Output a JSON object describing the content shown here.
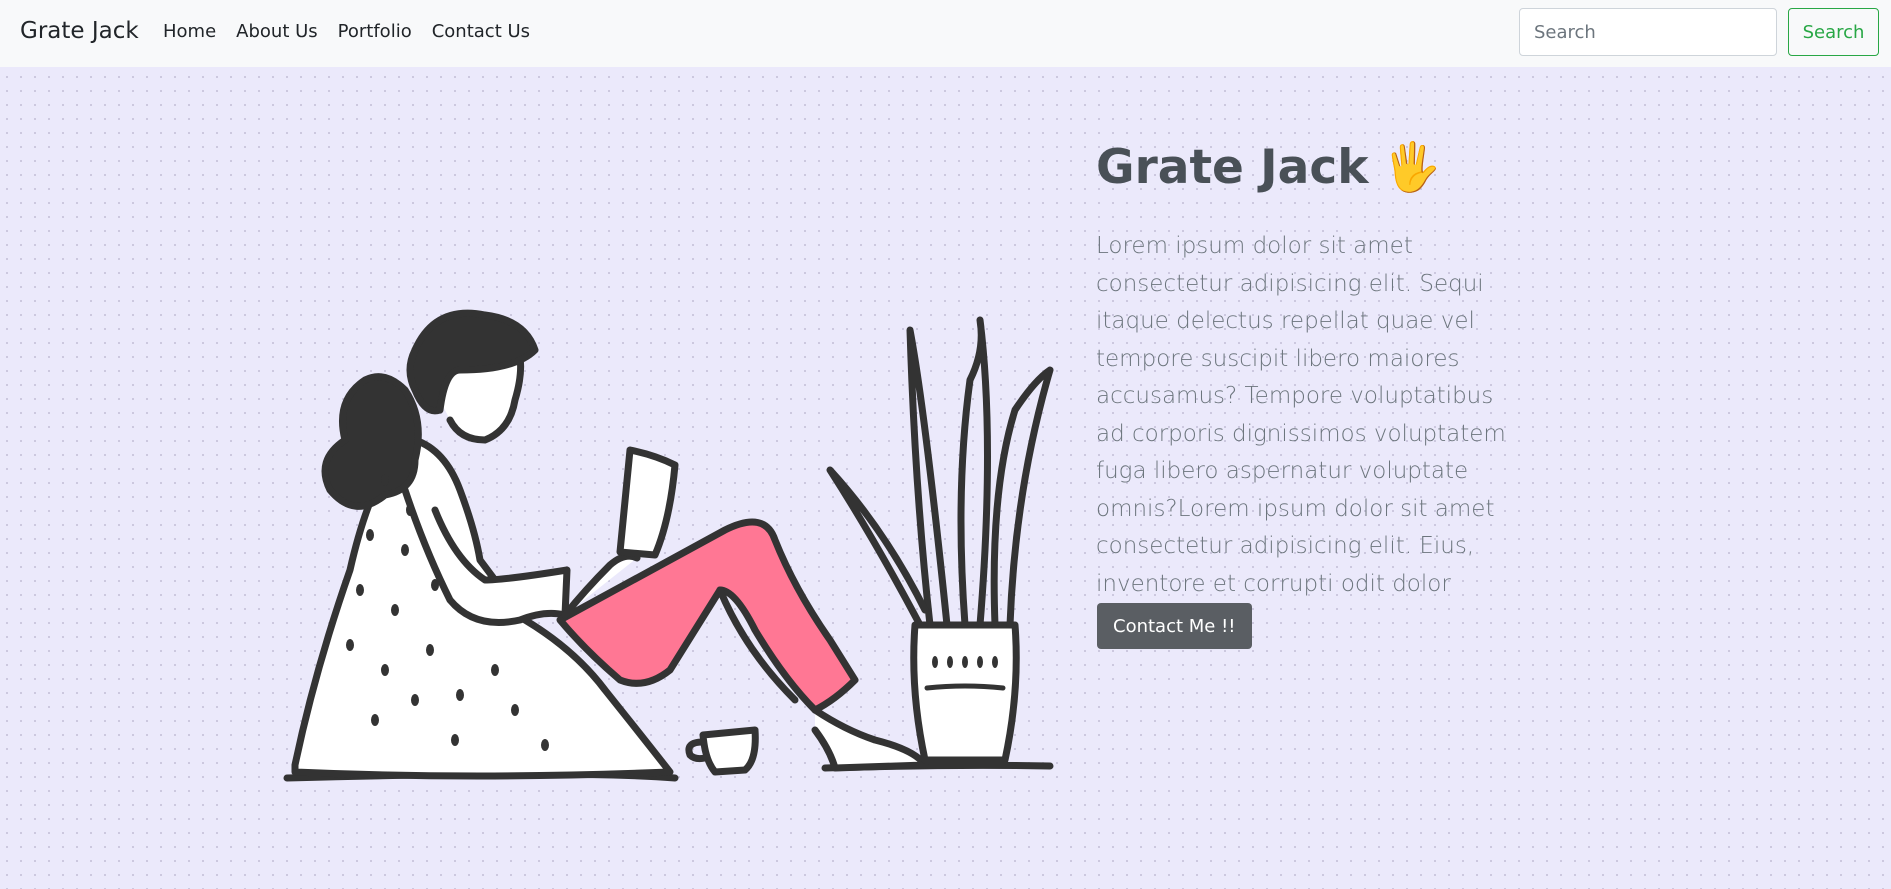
{
  "navbar": {
    "brand": "Grate Jack",
    "links": [
      "Home",
      "About Us",
      "Portfolio",
      "Contact Us"
    ],
    "search_placeholder": "Search",
    "search_button": "Search"
  },
  "hero": {
    "title": "Grate Jack",
    "title_emoji": "🖐",
    "text": "Lorem ipsum dolor sit amet consectetur adipisicing elit. Sequi itaque delectus repellat quae vel tempore suscipit libero maiores accusamus? Tempore voluptatibus ad corporis dignissimos voluptatem fuga libero aspernatur voluptate omnis?Lorem ipsum dolor sit amet consectetur adipisicing elit. Eius, inventore et corrupti odit dolor praesentium",
    "button": "Contact Me !!"
  },
  "colors": {
    "page_background": "#ebe9fb",
    "navbar_background": "#f8f9fa",
    "search_button_accent": "#28a745",
    "contact_button": "#5a5e63",
    "pants": "#ff7794",
    "outline": "#333333"
  },
  "illustration": {
    "subject": "woman-reading-phone-with-plant-illustration"
  }
}
